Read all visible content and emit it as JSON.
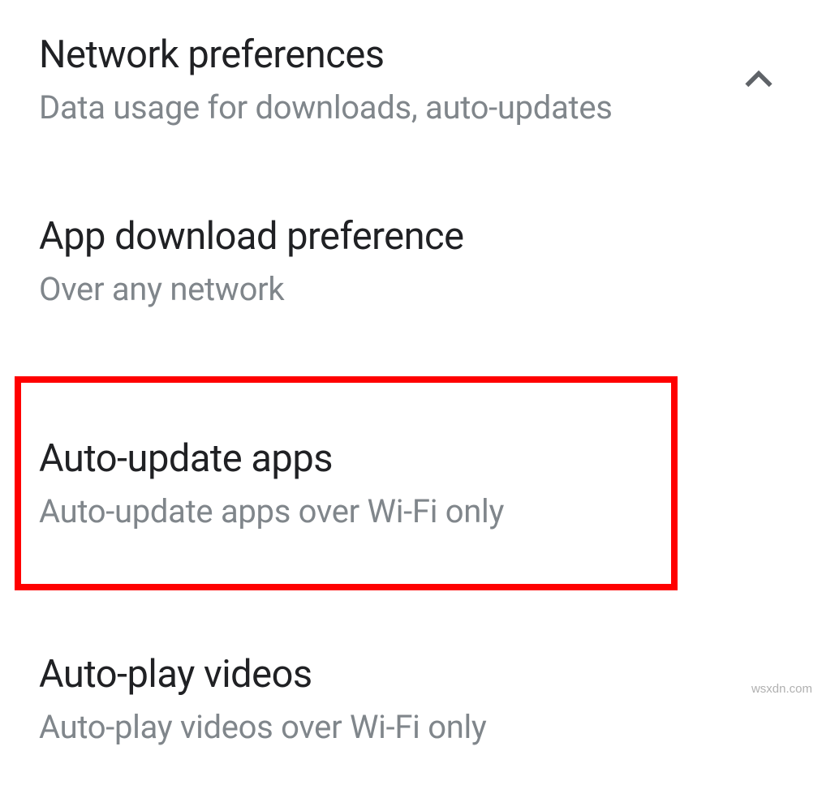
{
  "section": {
    "title": "Network preferences",
    "subtitle": "Data usage for downloads, auto-updates"
  },
  "settings": [
    {
      "title": "App download preference",
      "value": "Over any network"
    },
    {
      "title": "Auto-update apps",
      "value": "Auto-update apps over Wi-Fi only"
    },
    {
      "title": "Auto-play videos",
      "value": "Auto-play videos over Wi-Fi only"
    }
  ],
  "watermark": "wsxdn.com"
}
